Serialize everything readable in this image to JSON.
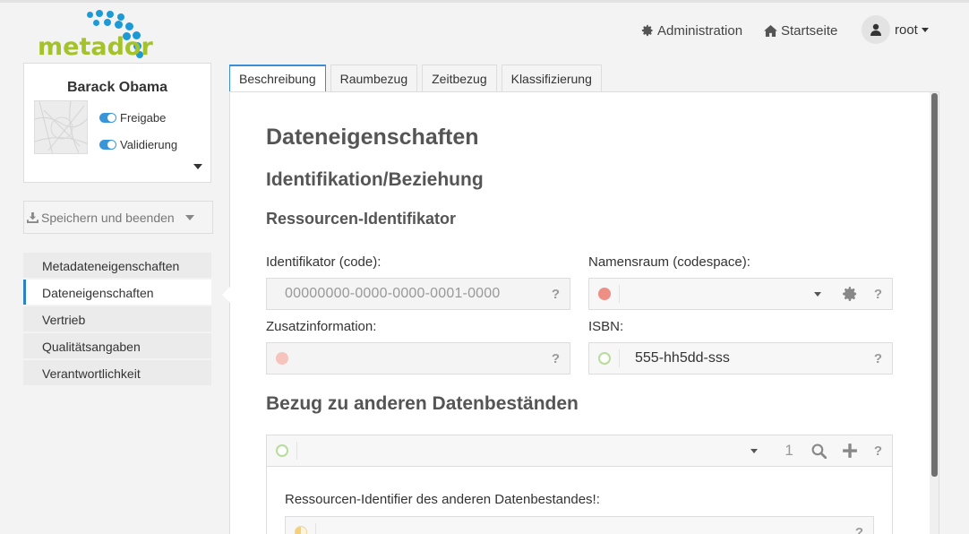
{
  "brand": {
    "name": "metador"
  },
  "topnav": {
    "admin": "Administration",
    "home": "Startseite",
    "user": "root"
  },
  "card": {
    "title": "Barack Obama",
    "toggle1": "Freigabe",
    "toggle2": "Validierung"
  },
  "save_button": "Speichern und beenden",
  "sidenav": [
    "Metadateneigenschaften",
    "Dateneigenschaften",
    "Vertrieb",
    "Qualitätsangaben",
    "Verantwortlichkeit"
  ],
  "tabs": [
    "Beschreibung",
    "Raumbezug",
    "Zeitbezug",
    "Klassifizierung"
  ],
  "content": {
    "title": "Dateneigenschaften",
    "section": "Identifikation/Beziehung",
    "subsection": "Ressourcen-Identifikator",
    "code_label": "Identifikator (code):",
    "code_value": "00000000-0000-0000-0001-0000",
    "codespace_label": "Namensraum (codespace):",
    "extra_label": "Zusatzinformation:",
    "isbn_label": "ISBN:",
    "isbn_value": "555-hh5dd-sss",
    "help": "?",
    "related_title": "Bezug zu anderen Datenbeständen",
    "related_count": "1",
    "related_field_label": "Ressourcen-Identifier des anderen Datenbestandes!:"
  },
  "colors": {
    "accent": "#3c8ed4",
    "logo_green": "#a4c22a",
    "logo_blue": "#1d9ad6"
  }
}
